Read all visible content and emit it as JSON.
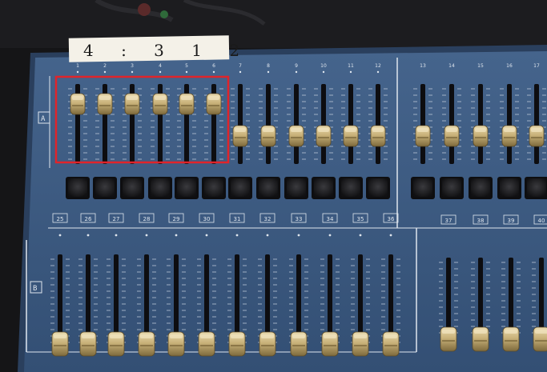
{
  "label_strip": {
    "text": "4 : 3 1 2"
  },
  "upper_channel_numbers": [
    "1",
    "2",
    "3",
    "4",
    "5",
    "6",
    "7",
    "8",
    "9",
    "10",
    "11",
    "12"
  ],
  "right_channel_numbers": [
    "13",
    "14",
    "15",
    "16",
    "17",
    "18"
  ],
  "lower_channel_numbers": [
    "25",
    "26",
    "27",
    "28",
    "29",
    "30",
    "31",
    "32",
    "33",
    "34",
    "35",
    "36"
  ],
  "lower_right_numbers": [
    "37",
    "38",
    "39",
    "40"
  ],
  "section_labels": {
    "upper": "A",
    "lower": "B"
  },
  "highlight": {
    "color": "#e0242a",
    "covers_upper_faders": 6
  },
  "colors": {
    "panel": "#3f5d84",
    "panel_dark": "#2b4260",
    "fader_cap": "#c9b27a",
    "fader_cap_shadow": "#7e6a3c",
    "button": "#1e1e20",
    "print": "#dfe6ee"
  },
  "fader_levels": {
    "upper_left_block": 0.75,
    "upper_middle_block": 0.35,
    "upper_right_block": 0.35,
    "lower_row": 0.0
  }
}
